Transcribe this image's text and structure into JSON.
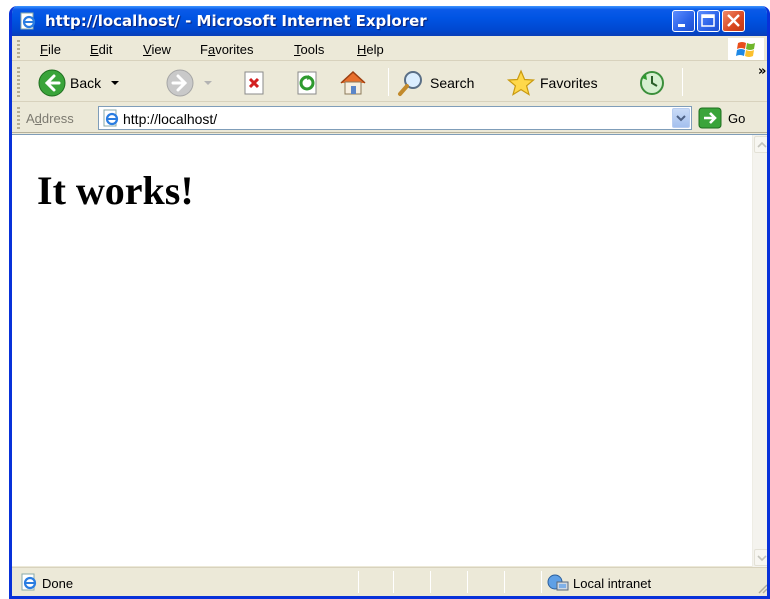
{
  "window": {
    "title": "http://localhost/ - Microsoft Internet Explorer"
  },
  "menu": {
    "items": [
      {
        "pre": "",
        "ul": "F",
        "post": "ile"
      },
      {
        "pre": "",
        "ul": "E",
        "post": "dit"
      },
      {
        "pre": "",
        "ul": "V",
        "post": "iew"
      },
      {
        "pre": "F",
        "ul": "a",
        "post": "vorites"
      },
      {
        "pre": "",
        "ul": "T",
        "post": "ools"
      },
      {
        "pre": "",
        "ul": "H",
        "post": "elp"
      }
    ]
  },
  "toolbar": {
    "back_label": "Back",
    "search_label": "Search",
    "favorites_label": "Favorites",
    "overflow": "»",
    "icons": [
      "back-icon",
      "forward-icon",
      "stop-icon",
      "refresh-icon",
      "home-icon",
      "search-icon",
      "favorites-icon",
      "history-icon"
    ]
  },
  "address": {
    "label_pre": "A",
    "label_ul": "d",
    "label_post": "dress",
    "url": "http://localhost/",
    "go_label": "Go"
  },
  "page": {
    "heading": "It works!"
  },
  "status": {
    "text": "Done",
    "zone": "Local intranet"
  },
  "colors": {
    "titlebar": "#0054e3",
    "window_border": "#0831d9",
    "chrome": "#ece9d8",
    "close_button": "#d9471f",
    "content_bg": "#ffffff"
  }
}
